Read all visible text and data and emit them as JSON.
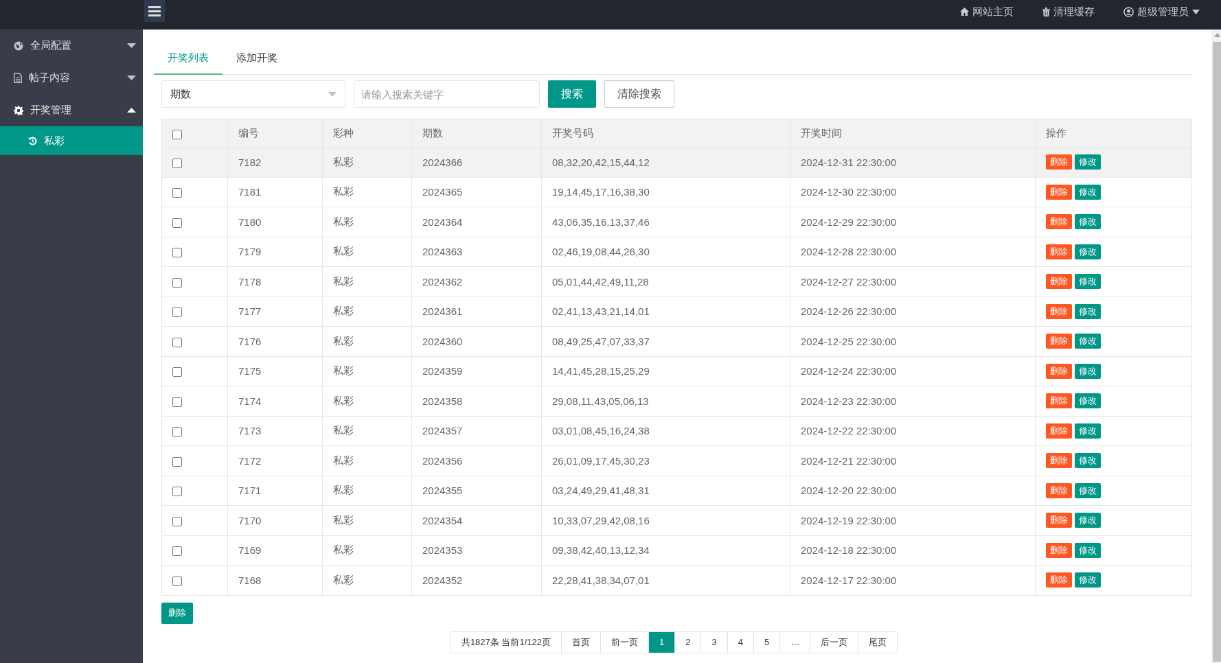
{
  "header": {
    "links": [
      {
        "kind": "home",
        "label": "网站主页"
      },
      {
        "kind": "trash",
        "label": "清理缓存"
      },
      {
        "kind": "user",
        "label": "超级管理员"
      }
    ]
  },
  "sidebar": {
    "items": [
      {
        "kind": "globe",
        "label": "全局配置",
        "expanded": false
      },
      {
        "kind": "doc",
        "label": "帖子内容",
        "expanded": false
      },
      {
        "kind": "gear",
        "label": "开奖管理",
        "expanded": true,
        "children": [
          {
            "kind": "history",
            "label": "私彩",
            "selected": true
          }
        ]
      }
    ]
  },
  "tabs": [
    {
      "label": "开奖列表",
      "selected": true
    },
    {
      "label": "添加开奖",
      "selected": false
    }
  ],
  "search": {
    "field_select": "期数",
    "placeholder": "请输入搜索关键字",
    "search_button": "搜索",
    "clear_button": "清除搜索"
  },
  "table": {
    "columns": [
      "编号",
      "彩种",
      "期数",
      "开奖号码",
      "开奖时间",
      "操作"
    ],
    "all_checked": false,
    "rows": [
      {
        "cells": [
          "7182",
          "私彩",
          "2024366",
          "08,32,20,42,15,44,12",
          "2024-12-31 22:30:00"
        ],
        "actions": [
          "删除",
          "修改"
        ],
        "checked": false,
        "selected": true
      },
      {
        "cells": [
          "7181",
          "私彩",
          "2024365",
          "19,14,45,17,16,38,30",
          "2024-12-30 22:30:00"
        ],
        "actions": [
          "删除",
          "修改"
        ],
        "checked": false,
        "selected": false
      },
      {
        "cells": [
          "7180",
          "私彩",
          "2024364",
          "43,06,35,16,13,37,46",
          "2024-12-29 22:30:00"
        ],
        "actions": [
          "删除",
          "修改"
        ],
        "checked": false,
        "selected": false
      },
      {
        "cells": [
          "7179",
          "私彩",
          "2024363",
          "02,46,19,08,44,26,30",
          "2024-12-28 22:30:00"
        ],
        "actions": [
          "删除",
          "修改"
        ],
        "checked": false,
        "selected": false
      },
      {
        "cells": [
          "7178",
          "私彩",
          "2024362",
          "05,01,44,42,49,11,28",
          "2024-12-27 22:30:00"
        ],
        "actions": [
          "删除",
          "修改"
        ],
        "checked": false,
        "selected": false
      },
      {
        "cells": [
          "7177",
          "私彩",
          "2024361",
          "02,41,13,43,21,14,01",
          "2024-12-26 22:30:00"
        ],
        "actions": [
          "删除",
          "修改"
        ],
        "checked": false,
        "selected": false
      },
      {
        "cells": [
          "7176",
          "私彩",
          "2024360",
          "08,49,25,47,07,33,37",
          "2024-12-25 22:30:00"
        ],
        "actions": [
          "删除",
          "修改"
        ],
        "checked": false,
        "selected": false
      },
      {
        "cells": [
          "7175",
          "私彩",
          "2024359",
          "14,41,45,28,15,25,29",
          "2024-12-24 22:30:00"
        ],
        "actions": [
          "删除",
          "修改"
        ],
        "checked": false,
        "selected": false
      },
      {
        "cells": [
          "7174",
          "私彩",
          "2024358",
          "29,08,11,43,05,06,13",
          "2024-12-23 22:30:00"
        ],
        "actions": [
          "删除",
          "修改"
        ],
        "checked": false,
        "selected": false
      },
      {
        "cells": [
          "7173",
          "私彩",
          "2024357",
          "03,01,08,45,16,24,38",
          "2024-12-22 22:30:00"
        ],
        "actions": [
          "删除",
          "修改"
        ],
        "checked": false,
        "selected": false
      },
      {
        "cells": [
          "7172",
          "私彩",
          "2024356",
          "26,01,09,17,45,30,23",
          "2024-12-21 22:30:00"
        ],
        "actions": [
          "删除",
          "修改"
        ],
        "checked": false,
        "selected": false
      },
      {
        "cells": [
          "7171",
          "私彩",
          "2024355",
          "03,24,49,29,41,48,31",
          "2024-12-20 22:30:00"
        ],
        "actions": [
          "删除",
          "修改"
        ],
        "checked": false,
        "selected": false
      },
      {
        "cells": [
          "7170",
          "私彩",
          "2024354",
          "10,33,07,29,42,08,16",
          "2024-12-19 22:30:00"
        ],
        "actions": [
          "删除",
          "修改"
        ],
        "checked": false,
        "selected": false
      },
      {
        "cells": [
          "7169",
          "私彩",
          "2024353",
          "09,38,42,40,13,12,34",
          "2024-12-18 22:30:00"
        ],
        "actions": [
          "删除",
          "修改"
        ],
        "checked": false,
        "selected": false
      },
      {
        "cells": [
          "7168",
          "私彩",
          "2024352",
          "22,28,41,38,34,07,01",
          "2024-12-17 22:30:00"
        ],
        "actions": [
          "删除",
          "修改"
        ],
        "checked": false,
        "selected": false
      }
    ]
  },
  "bulk_delete_button": "删除",
  "pagination": {
    "summary": "共1827条 当前1/122页",
    "first": "首页",
    "prev": "前一页",
    "pages": [
      {
        "label": "1",
        "selected": true
      },
      {
        "label": "2",
        "selected": false
      },
      {
        "label": "3",
        "selected": false
      },
      {
        "label": "4",
        "selected": false
      },
      {
        "label": "5",
        "selected": false
      }
    ],
    "ellipsis": "…",
    "next": "后一页",
    "last": "尾页"
  }
}
